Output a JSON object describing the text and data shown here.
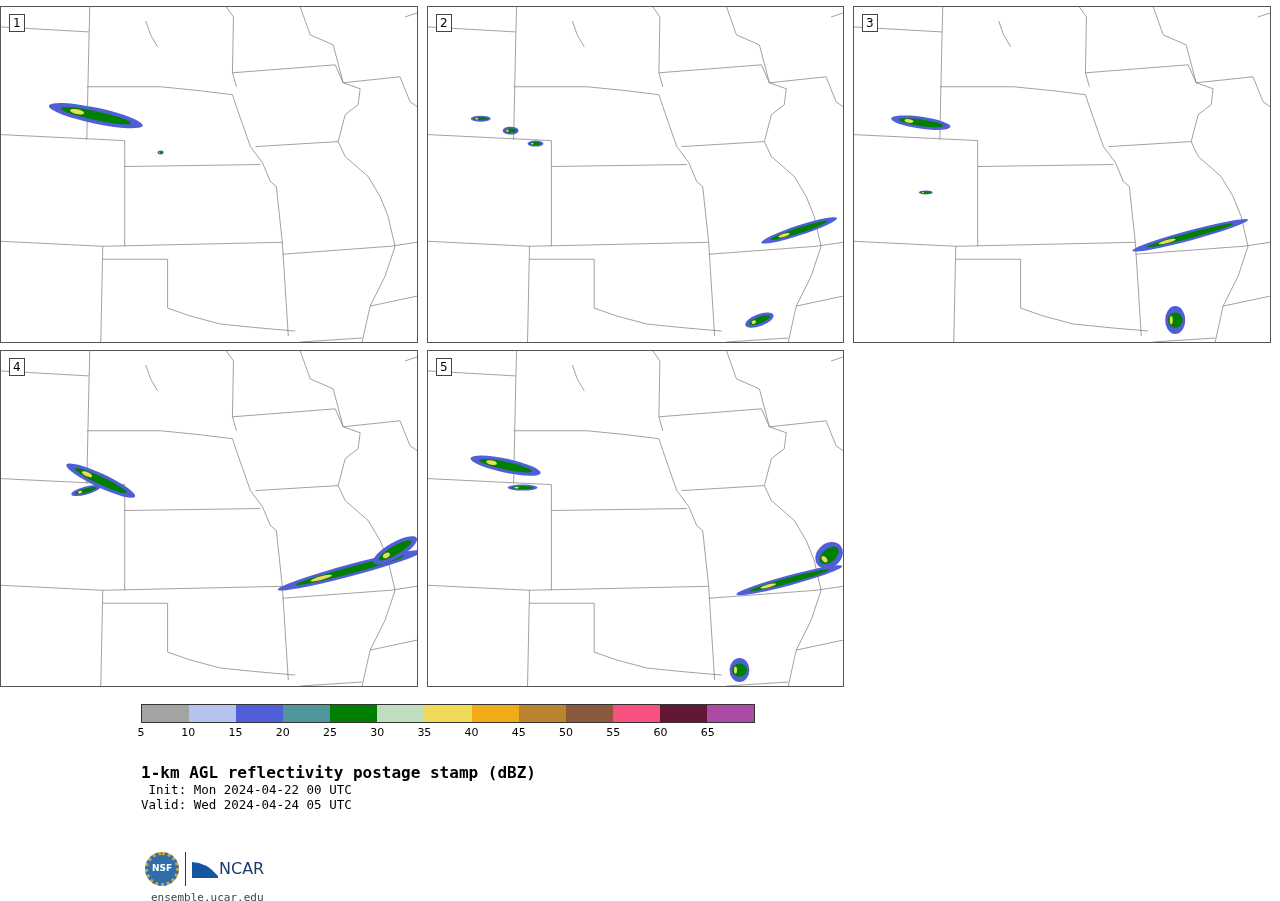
{
  "panels": [
    {
      "label": "1"
    },
    {
      "label": "2"
    },
    {
      "label": "3"
    },
    {
      "label": "4"
    },
    {
      "label": "5"
    }
  ],
  "colorbar": {
    "segments": [
      {
        "color": "#a3a3a3"
      },
      {
        "color": "#b7c3ef"
      },
      {
        "color": "#515fd6"
      },
      {
        "color": "#4f959c"
      },
      {
        "color": "#008000"
      },
      {
        "color": "#bfdebf"
      },
      {
        "color": "#f0da5c"
      },
      {
        "color": "#f0ab17"
      },
      {
        "color": "#ba842f"
      },
      {
        "color": "#8b5a3e"
      },
      {
        "color": "#f75180"
      },
      {
        "color": "#621735"
      },
      {
        "color": "#ad4ba4"
      }
    ],
    "ticks": [
      "5",
      "10",
      "15",
      "20",
      "25",
      "30",
      "35",
      "40",
      "45",
      "50",
      "55",
      "60",
      "65"
    ]
  },
  "title": "1-km AGL reflectivity postage stamp (dBZ)",
  "init": " Init: Mon 2024-04-22 00 UTC",
  "valid": "Valid: Wed 2024-04-24 05 UTC",
  "logos": {
    "nsf": "NSF",
    "ncar": "NCAR"
  },
  "url": "ensemble.ucar.edu"
}
